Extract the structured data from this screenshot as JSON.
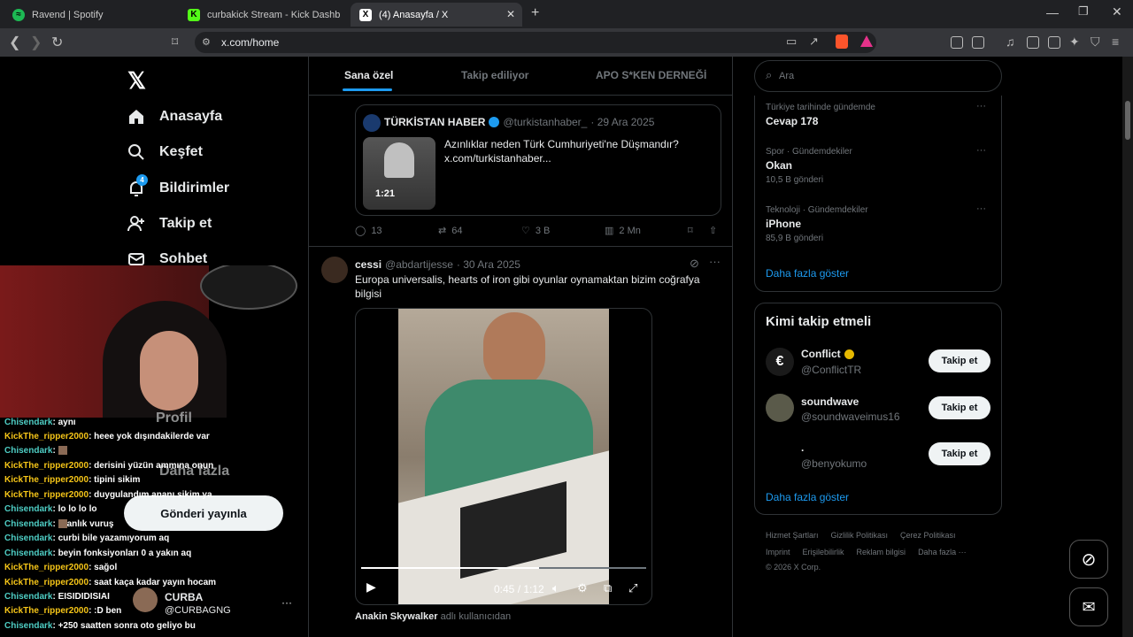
{
  "browser": {
    "tabs": [
      {
        "title": "Ravend | Spotify"
      },
      {
        "title": "curbakick Stream - Kick Dashboa"
      },
      {
        "title": "(4) Anasayfa / X"
      }
    ],
    "url": "x.com/home"
  },
  "nav": {
    "home": "Anasayfa",
    "explore": "Keşfet",
    "notifications": "Bildirimler",
    "notifications_badge": "4",
    "follow": "Takip et",
    "messages": "Sohbet",
    "profile": "Profil",
    "more": "Daha fazla",
    "post_button": "Gönderi yayınla",
    "account_name": "CURBA",
    "account_handle": "@CURBAGNG",
    "account_more": "···"
  },
  "feed": {
    "tabs": [
      "Sana özel",
      "Takip ediliyor",
      "APO S*KEN DERNEĞİ"
    ],
    "quoted": {
      "author": "TÜRKİSTAN HABER",
      "handle": "@turkistanhaber_",
      "date": "· 29 Ara 2025",
      "text": "Azınlıklar neden Türk Cumhuriyeti'ne Düşmandır? x.com/turkistanhaber...",
      "duration": "1:21"
    },
    "actions1": {
      "replies": "13",
      "reposts": "64",
      "likes": "3 B",
      "views": "2 Mn"
    },
    "post2": {
      "author": "cessi",
      "handle": "@abdartijesse",
      "date": "· 30 Ara 2025",
      "text": "Europa universalis, hearts of iron gibi oyunlar oynamaktan bizim coğrafya bilgisi",
      "video_time": "0:45 / 1:12",
      "video_progress": 0.625
    },
    "next_author": "Anakin Skywalker",
    "next_suffix": "adlı kullanıcıdan"
  },
  "sidebar": {
    "search_placeholder": "Ara",
    "trends": [
      {
        "context": "Türkiye tarihinde gündemde",
        "name": "Cevap 178",
        "count": ""
      },
      {
        "context": "Spor · Gündemdekiler",
        "name": "Okan",
        "count": "10,5 B gönderi"
      },
      {
        "context": "Teknoloji · Gündemdekiler",
        "name": "iPhone",
        "count": "85,9 B gönderi"
      }
    ],
    "show_more": "Daha fazla göster",
    "who_title": "Kimi takip etmeli",
    "who": [
      {
        "name": "Conflict",
        "handle": "@ConflictTR",
        "button": "Takip et"
      },
      {
        "name": "soundwave",
        "handle": "@soundwaveimus16",
        "button": "Takip et"
      },
      {
        "name": ".",
        "handle": "@benyokumo",
        "button": "Takip et"
      }
    ],
    "show_more2": "Daha fazla göster",
    "footer_line1": [
      "Hizmet Şartları",
      "Gizlilik Politikası",
      "Çerez Politikası"
    ],
    "footer_line2": [
      "Imprint",
      "Erişilebilirlik",
      "Reklam bilgisi",
      "Daha fazla ···"
    ],
    "copyright": "© 2026 X Corp."
  },
  "chat": [
    {
      "user": "Chisendark",
      "msg": "aynı"
    },
    {
      "user": "KickThe_ripper2000",
      "msg": "heee yok dışındakilerde var"
    },
    {
      "user": "Chisendark",
      "msg": ""
    },
    {
      "user": "KickThe_ripper2000",
      "msg": "derisini yüzün ammına onun"
    },
    {
      "user": "KickThe_ripper2000",
      "msg": "tipini sikim"
    },
    {
      "user": "KickThe_ripper2000",
      "msg": "duygulandım ananı sikim ya"
    },
    {
      "user": "Chisendark",
      "msg": "lo lo lo lo"
    },
    {
      "user": "Chisendark",
      "msg": "anlık vuruş"
    },
    {
      "user": "Chisendark",
      "msg": "curbi bile yazamıyorum aq"
    },
    {
      "user": "Chisendark",
      "msg": "beyin fonksiyonları 0 a yakın aq"
    },
    {
      "user": "KickThe_ripper2000",
      "msg": "sağol"
    },
    {
      "user": "KickThe_ripper2000",
      "msg": "saat kaça kadar yayın hocam"
    },
    {
      "user": "Chisendark",
      "msg": "EISIDIDISIAI"
    },
    {
      "user": "KickThe_ripper2000",
      "msg": ":D ben"
    },
    {
      "user": "Chisendark",
      "msg": "+250 saatten sonra oto geliyo bu"
    }
  ],
  "colors": {
    "accent": "#1d9bf0",
    "chis": "#4ecdc4",
    "kick": "#f5c518"
  }
}
